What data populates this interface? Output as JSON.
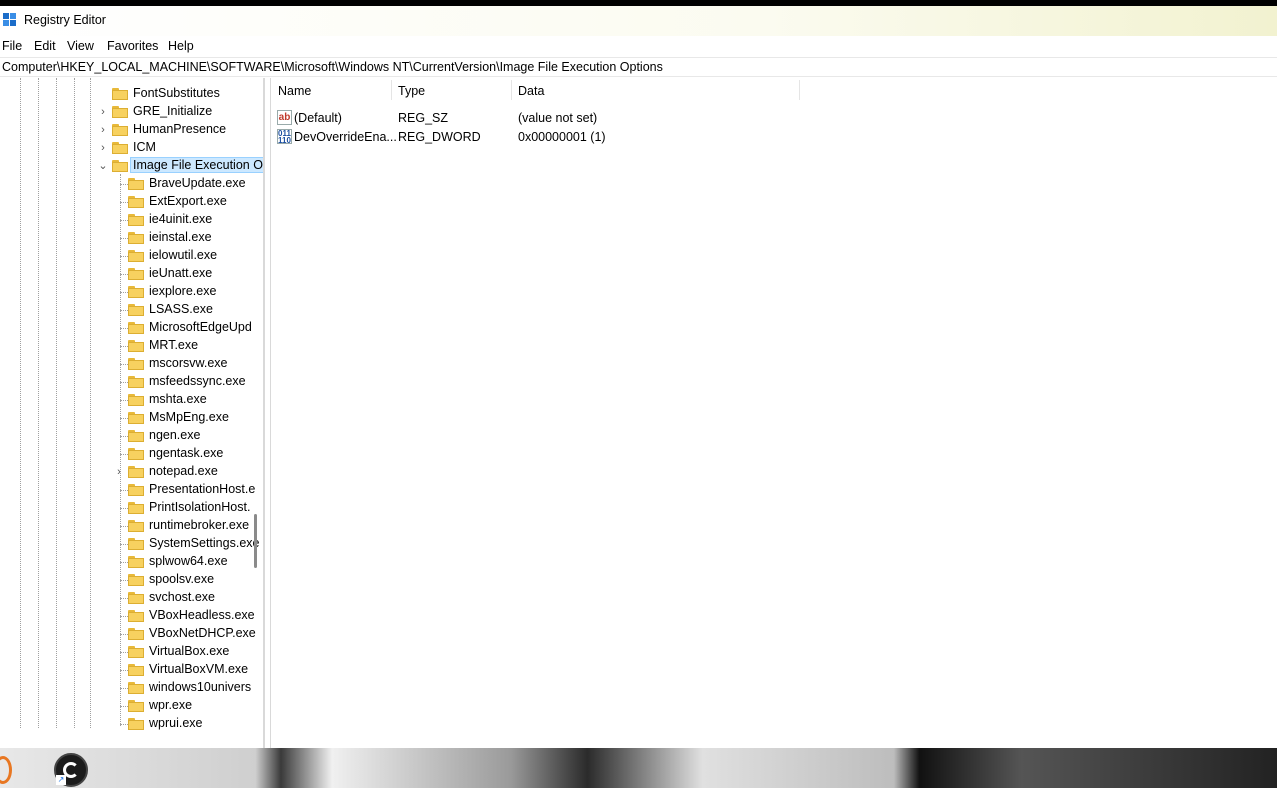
{
  "window": {
    "title": "Registry Editor"
  },
  "menubar": {
    "items": [
      "File",
      "Edit",
      "View",
      "Favorites",
      "Help"
    ]
  },
  "address": {
    "path": "Computer\\HKEY_LOCAL_MACHINE\\SOFTWARE\\Microsoft\\Windows NT\\CurrentVersion\\Image File Execution Options"
  },
  "tree": {
    "parents": [
      {
        "label": "FontSubstitutes",
        "expander": ""
      },
      {
        "label": "GRE_Initialize",
        "expander": "›"
      },
      {
        "label": "HumanPresence",
        "expander": "›"
      },
      {
        "label": "ICM",
        "expander": "›"
      },
      {
        "label": "Image File Execution O",
        "expander": "⌄",
        "selected": true
      }
    ],
    "children": [
      {
        "label": "BraveUpdate.exe",
        "expander": ""
      },
      {
        "label": "ExtExport.exe",
        "expander": ""
      },
      {
        "label": "ie4uinit.exe",
        "expander": ""
      },
      {
        "label": "ieinstal.exe",
        "expander": ""
      },
      {
        "label": "ielowutil.exe",
        "expander": ""
      },
      {
        "label": "ieUnatt.exe",
        "expander": ""
      },
      {
        "label": "iexplore.exe",
        "expander": ""
      },
      {
        "label": "LSASS.exe",
        "expander": ""
      },
      {
        "label": "MicrosoftEdgeUpd",
        "expander": ""
      },
      {
        "label": "MRT.exe",
        "expander": ""
      },
      {
        "label": "mscorsvw.exe",
        "expander": ""
      },
      {
        "label": "msfeedssync.exe",
        "expander": ""
      },
      {
        "label": "mshta.exe",
        "expander": ""
      },
      {
        "label": "MsMpEng.exe",
        "expander": ""
      },
      {
        "label": "ngen.exe",
        "expander": ""
      },
      {
        "label": "ngentask.exe",
        "expander": ""
      },
      {
        "label": "notepad.exe",
        "expander": "›"
      },
      {
        "label": "PresentationHost.e",
        "expander": ""
      },
      {
        "label": "PrintIsolationHost.",
        "expander": ""
      },
      {
        "label": "runtimebroker.exe",
        "expander": ""
      },
      {
        "label": "SystemSettings.exe",
        "expander": ""
      },
      {
        "label": "splwow64.exe",
        "expander": ""
      },
      {
        "label": "spoolsv.exe",
        "expander": ""
      },
      {
        "label": "svchost.exe",
        "expander": ""
      },
      {
        "label": "VBoxHeadless.exe",
        "expander": ""
      },
      {
        "label": "VBoxNetDHCP.exe",
        "expander": ""
      },
      {
        "label": "VirtualBox.exe",
        "expander": ""
      },
      {
        "label": "VirtualBoxVM.exe",
        "expander": ""
      },
      {
        "label": "windows10univers",
        "expander": ""
      },
      {
        "label": "wpr.exe",
        "expander": ""
      },
      {
        "label": "wprui.exe",
        "expander": ""
      }
    ]
  },
  "list": {
    "columns": [
      "Name",
      "Type",
      "Data"
    ],
    "rows": [
      {
        "icon": "string-value-icon",
        "name": "(Default)",
        "type": "REG_SZ",
        "data": "(value not set)"
      },
      {
        "icon": "dword-value-icon",
        "name": "DevOverrideEna...",
        "type": "REG_DWORD",
        "data": "0x00000001 (1)"
      }
    ]
  },
  "colors": {
    "selection_bg": "#cce8ff",
    "selection_border": "#99d1ff",
    "folder": "#f7d15f",
    "app_icon": "#1c6dc9"
  }
}
